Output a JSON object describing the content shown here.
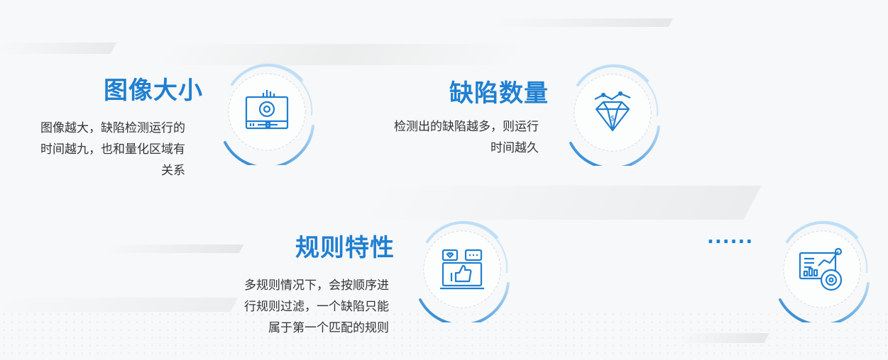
{
  "features": [
    {
      "title": "图像大小",
      "description": [
        "图像越大，缺陷检测运行的",
        "时间越九，也和量化区域有",
        "关系"
      ],
      "icon": "video-settings-icon"
    },
    {
      "title": "缺陷数量",
      "description": [
        "检测出的缺陷越多，则运行",
        "时间越久"
      ],
      "icon": "diamond-chart-icon"
    },
    {
      "title": "规则特性",
      "description": [
        "多规则情况下，会按顺序进",
        "行规则过滤，一个缺陷只能",
        "属于第一个匹配的规则"
      ],
      "icon": "social-like-icon"
    },
    {
      "title": "",
      "description": [],
      "icon": "analytics-dashboard-icon"
    }
  ],
  "more_indicator": "......",
  "colors": {
    "accent": "#1f7fd1",
    "ring_light": "#b9dcf5",
    "text": "#333333",
    "background": "#f7f8f9"
  }
}
